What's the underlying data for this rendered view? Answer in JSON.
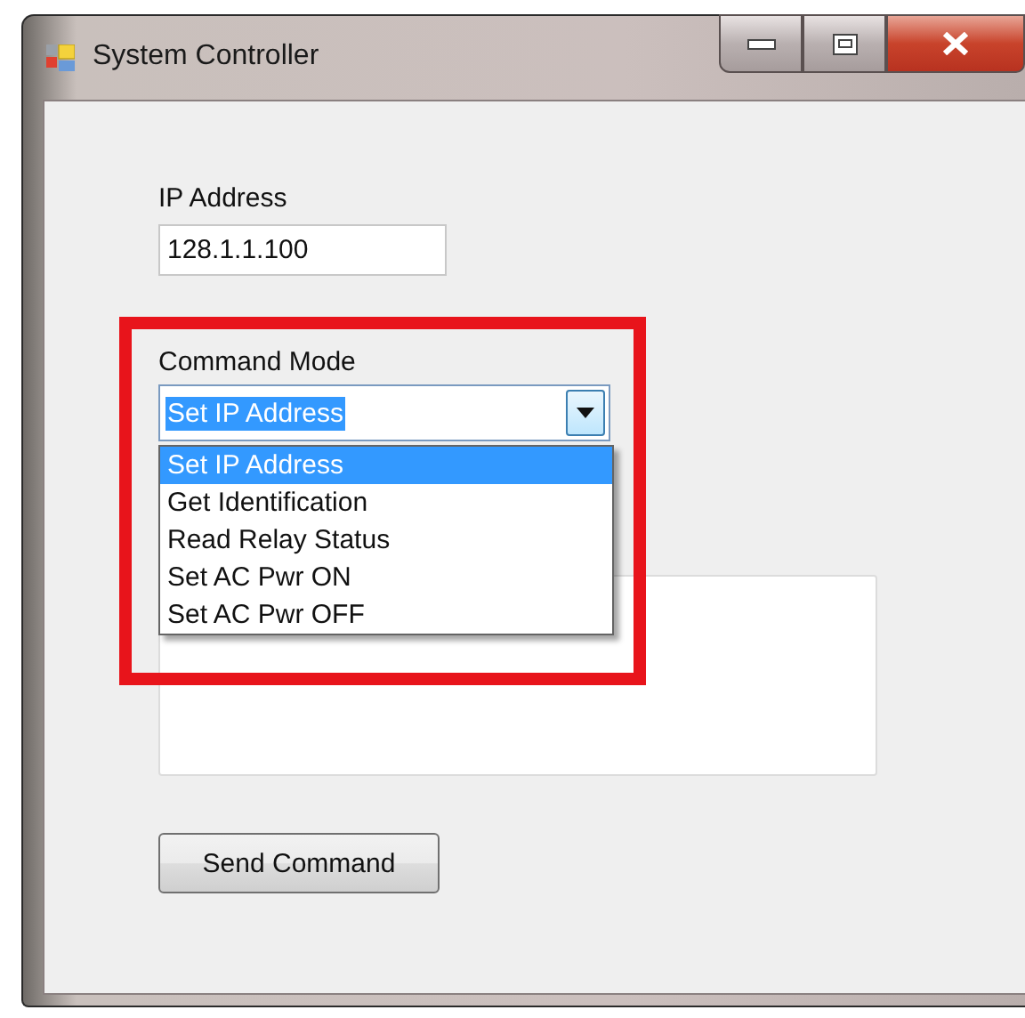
{
  "window": {
    "title": "System Controller"
  },
  "ip_address": {
    "label": "IP Address",
    "value": "128.1.1.100"
  },
  "command_mode": {
    "label": "Command Mode",
    "value": "Set IP Address",
    "expanded": true,
    "options": [
      {
        "label": "Set IP Address",
        "selected": true
      },
      {
        "label": "Get Identification",
        "selected": false
      },
      {
        "label": "Read Relay Status",
        "selected": false
      },
      {
        "label": "Set AC Pwr ON",
        "selected": false
      },
      {
        "label": "Set AC Pwr OFF",
        "selected": false
      }
    ]
  },
  "send_button": {
    "label": "Send Command"
  }
}
